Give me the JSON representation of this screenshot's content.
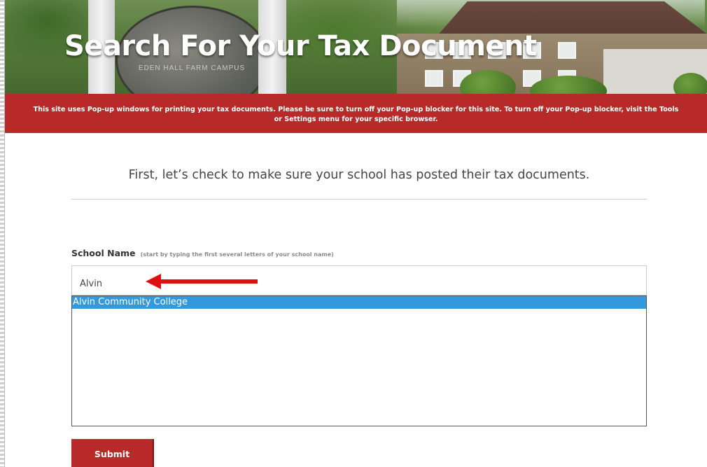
{
  "hero": {
    "title": "Search For Your Tax Document",
    "sign_text": "EDEN HALL FARM CAMPUS"
  },
  "notice": {
    "line1": "This site uses Pop-up windows for printing your tax documents. Please be sure to turn off your Pop-up blocker for this site. To turn off your Pop-up blocker, visit the Tools",
    "line2": "or Settings menu for your specific browser."
  },
  "intro": {
    "text": "First, let’s check to make sure your school has posted their tax documents."
  },
  "school_field": {
    "label": "School Name",
    "hint": "(start by typing the first several letters of your school name)",
    "value": "Alvin"
  },
  "suggestions": [
    {
      "label": "Alvin Community College",
      "selected": true
    }
  ],
  "submit": {
    "label": "Submit"
  },
  "colors": {
    "brand_red": "#b82a2a",
    "highlight_blue": "#3399dd",
    "annotation_arrow": "#e01010"
  },
  "icons": {
    "annotation": "left-arrow-icon"
  }
}
